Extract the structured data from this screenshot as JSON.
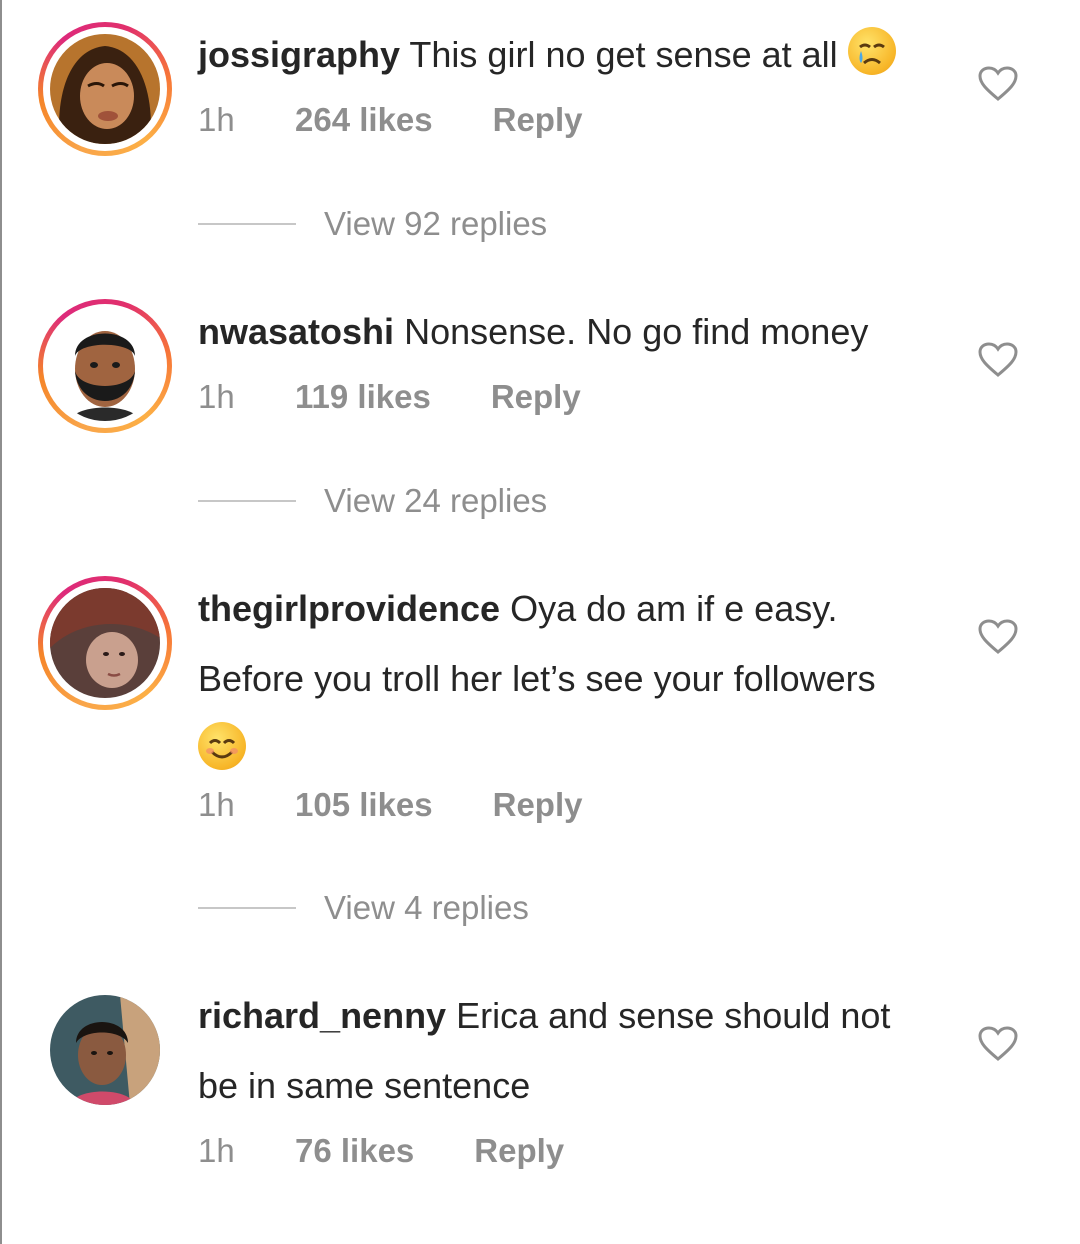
{
  "comments": [
    {
      "username": "jossigraphy",
      "text": "This girl no get sense at all",
      "emoji": "crying-face-emoji",
      "time": "1h",
      "likes": "264 likes",
      "reply_label": "Reply",
      "view_replies": "View 92 replies"
    },
    {
      "username": "nwasatoshi",
      "text": "Nonsense. No go find money",
      "time": "1h",
      "likes": "119 likes",
      "reply_label": "Reply",
      "view_replies": "View 24 replies"
    },
    {
      "username": "thegirlprovidence",
      "text": "Oya do am if e easy.",
      "text_line2": "Before you troll her let’s see your followers",
      "emoji": "smiling-face-emoji",
      "time": "1h",
      "likes": "105 likes",
      "reply_label": "Reply",
      "view_replies": "View 4 replies"
    },
    {
      "username": "richard_nenny",
      "text": "Erica and sense should not",
      "text_line2": "be in same sentence",
      "time": "1h",
      "likes": "76 likes",
      "reply_label": "Reply"
    }
  ],
  "colors": {
    "text": "#262626",
    "secondary": "#8e8e8e",
    "divider": "#c7c7c7"
  }
}
